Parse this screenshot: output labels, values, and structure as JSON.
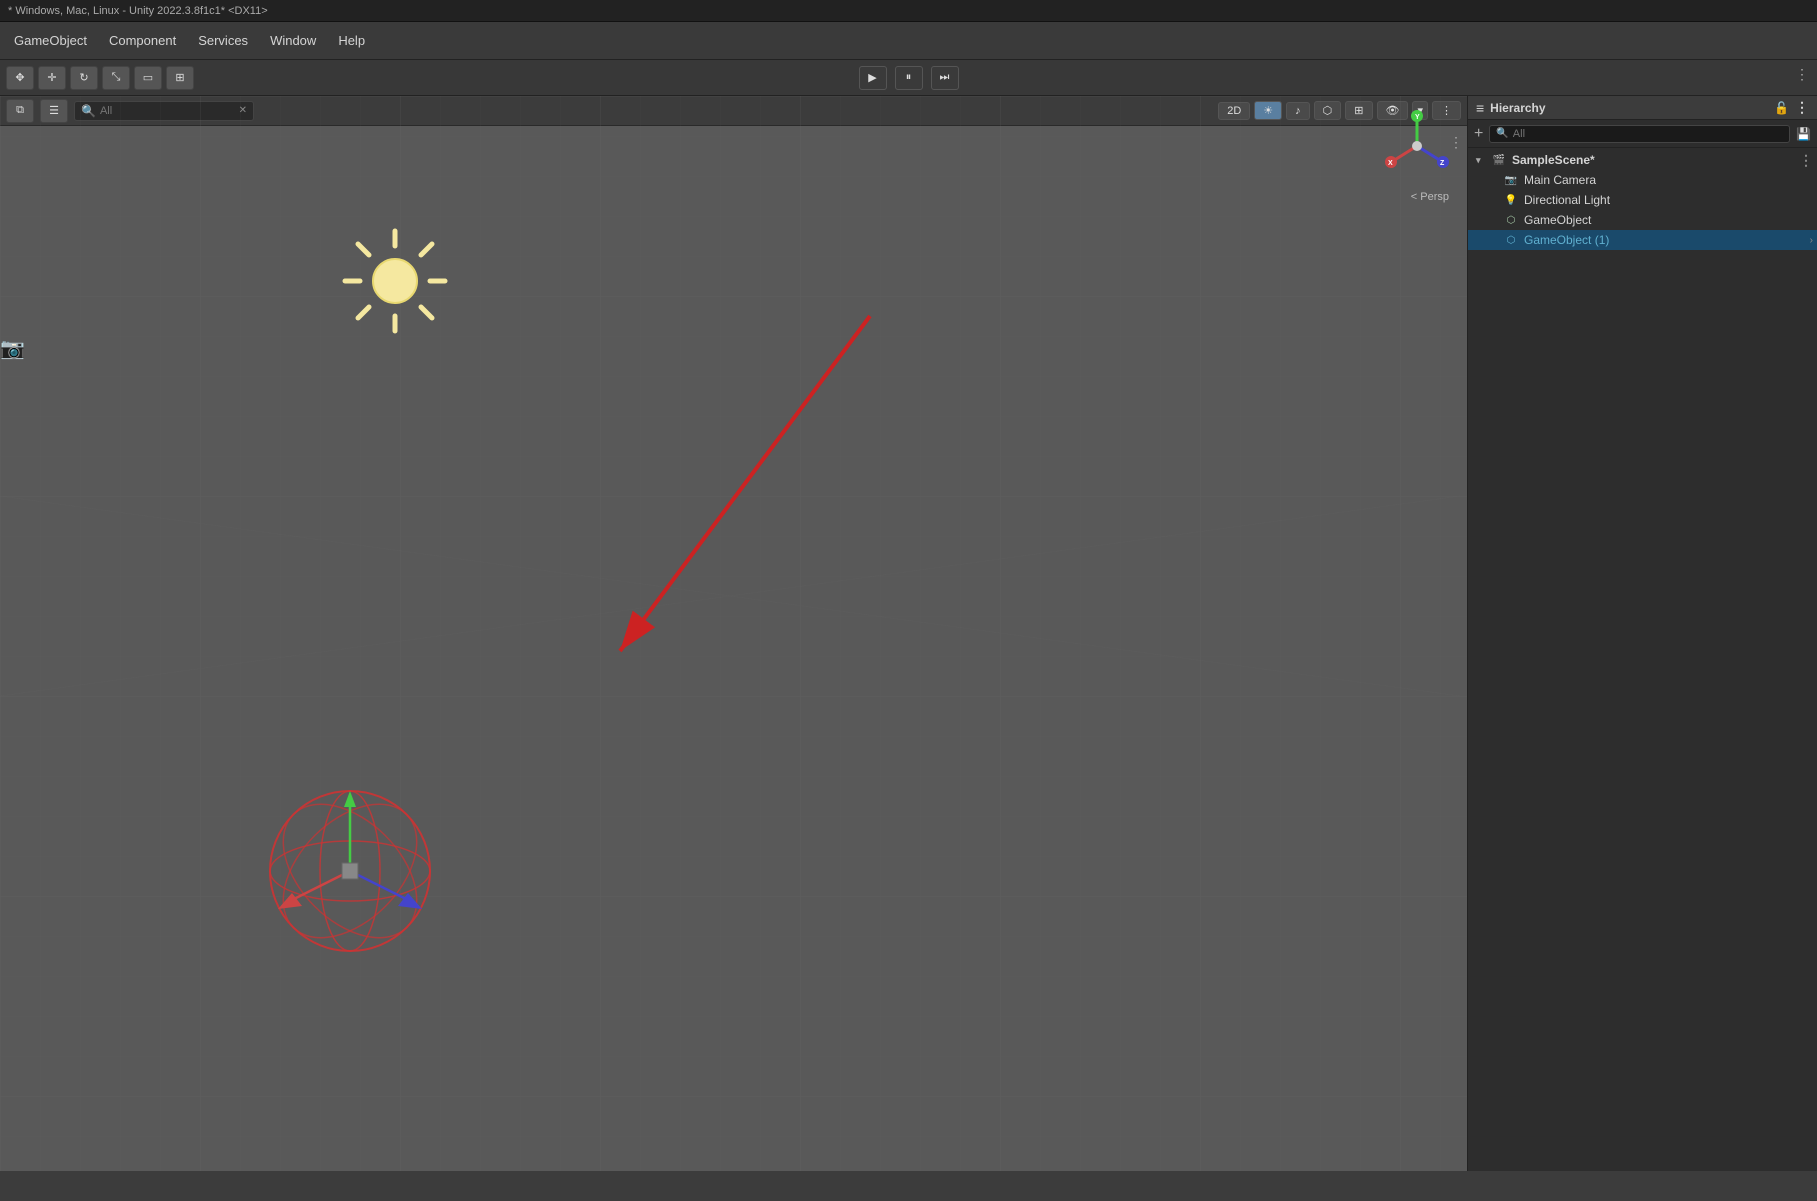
{
  "titlebar": {
    "text": "* Windows, Mac, Linux - Unity 2022.3.8f1c1* <DX11>"
  },
  "menubar": {
    "items": [
      {
        "label": "GameObject"
      },
      {
        "label": "Component"
      },
      {
        "label": "Services"
      },
      {
        "label": "Window"
      },
      {
        "label": "Help"
      }
    ]
  },
  "toolbar": {
    "play_label": "▶",
    "pause_label": "⏸",
    "step_label": "⏭"
  },
  "scene_toolbar": {
    "search_placeholder": "All",
    "mode_2d": "2D",
    "lighting_btn": "💡",
    "audio_btn": "🔊"
  },
  "hierarchy": {
    "title": "Hierarchy",
    "search_placeholder": "All",
    "scene_name": "SampleScene*",
    "items": [
      {
        "label": "Main Camera",
        "icon": "camera",
        "indent": 1
      },
      {
        "label": "Directional Light",
        "icon": "light",
        "indent": 1
      },
      {
        "label": "GameObject",
        "icon": "gameobj",
        "indent": 1
      },
      {
        "label": "GameObject (1)",
        "icon": "gameobj-selected",
        "indent": 1,
        "selected": true,
        "has_arrow": true
      }
    ]
  },
  "scene": {
    "persp_label": "< Persp",
    "annotation_dots": "⋮"
  },
  "colors": {
    "background": "#595959",
    "panel_bg": "#2d2d2d",
    "header_bg": "#3c3c3c",
    "accent_blue": "#1a4a6b",
    "selected_item": "#60b0d0"
  }
}
